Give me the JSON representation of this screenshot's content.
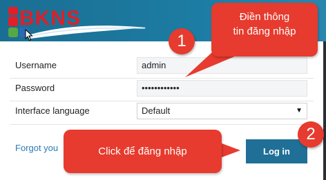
{
  "header": {
    "logo_text": "BKNS",
    "logo_colors": {
      "red": "#e21e26",
      "blue": "#2b6ab5",
      "green": "#56a845"
    }
  },
  "form": {
    "username_label": "Username",
    "username_value": "admin",
    "password_label": "Password",
    "password_value": "••••••••••••",
    "language_label": "Interface language",
    "language_value": "Default",
    "forgot_link": "Forgot you",
    "login_button": "Log in"
  },
  "annotations": {
    "step1_number": "1",
    "step1_text_line1": "Điền thông",
    "step1_text_line2": "tin đăng nhập",
    "step2_number": "2",
    "step2_text": "Click để đăng nhập",
    "accent_color": "#e63b2e"
  }
}
